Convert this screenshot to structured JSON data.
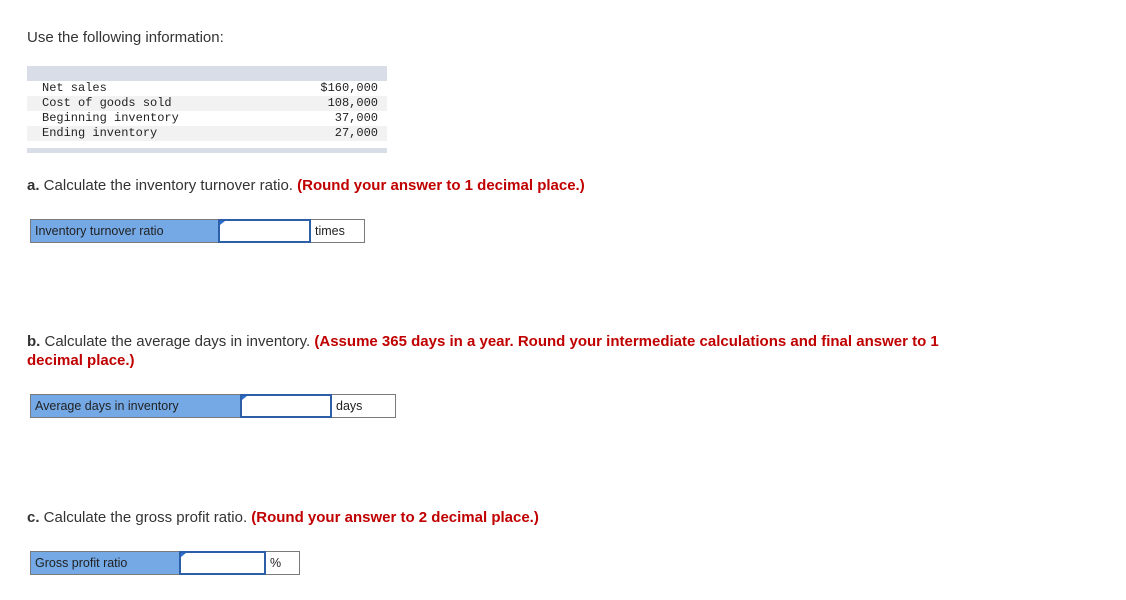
{
  "intro": "Use the following information:",
  "table": {
    "rows": [
      {
        "label": "Net sales",
        "value": "$160,000"
      },
      {
        "label": "Cost of goods sold",
        "value": "108,000"
      },
      {
        "label": "Beginning inventory",
        "value": "37,000"
      },
      {
        "label": "Ending inventory",
        "value": "27,000"
      }
    ]
  },
  "questions": {
    "a": {
      "letter": "a.",
      "text": " Calculate the inventory turnover ratio. ",
      "instruction": "(Round your answer to 1 decimal place.)",
      "answer_label": "Inventory turnover ratio",
      "answer_value": "",
      "unit": "times"
    },
    "b": {
      "letter": "b.",
      "text": " Calculate the average days in inventory. ",
      "instruction": "(Assume 365 days in a year. Round your intermediate calculations and final answer to 1 decimal place.)",
      "answer_label": "Average days in inventory",
      "answer_value": "",
      "unit": "days"
    },
    "c": {
      "letter": "c.",
      "text": " Calculate the gross profit ratio. ",
      "instruction": "(Round your answer to 2 decimal place.)",
      "answer_label": "Gross profit ratio",
      "answer_value": "",
      "unit": "%"
    }
  },
  "colors": {
    "instruction": "#c00000",
    "label_bg": "#74a9e6",
    "input_border": "#2d5fa8",
    "table_bar": "#d9dde8"
  }
}
